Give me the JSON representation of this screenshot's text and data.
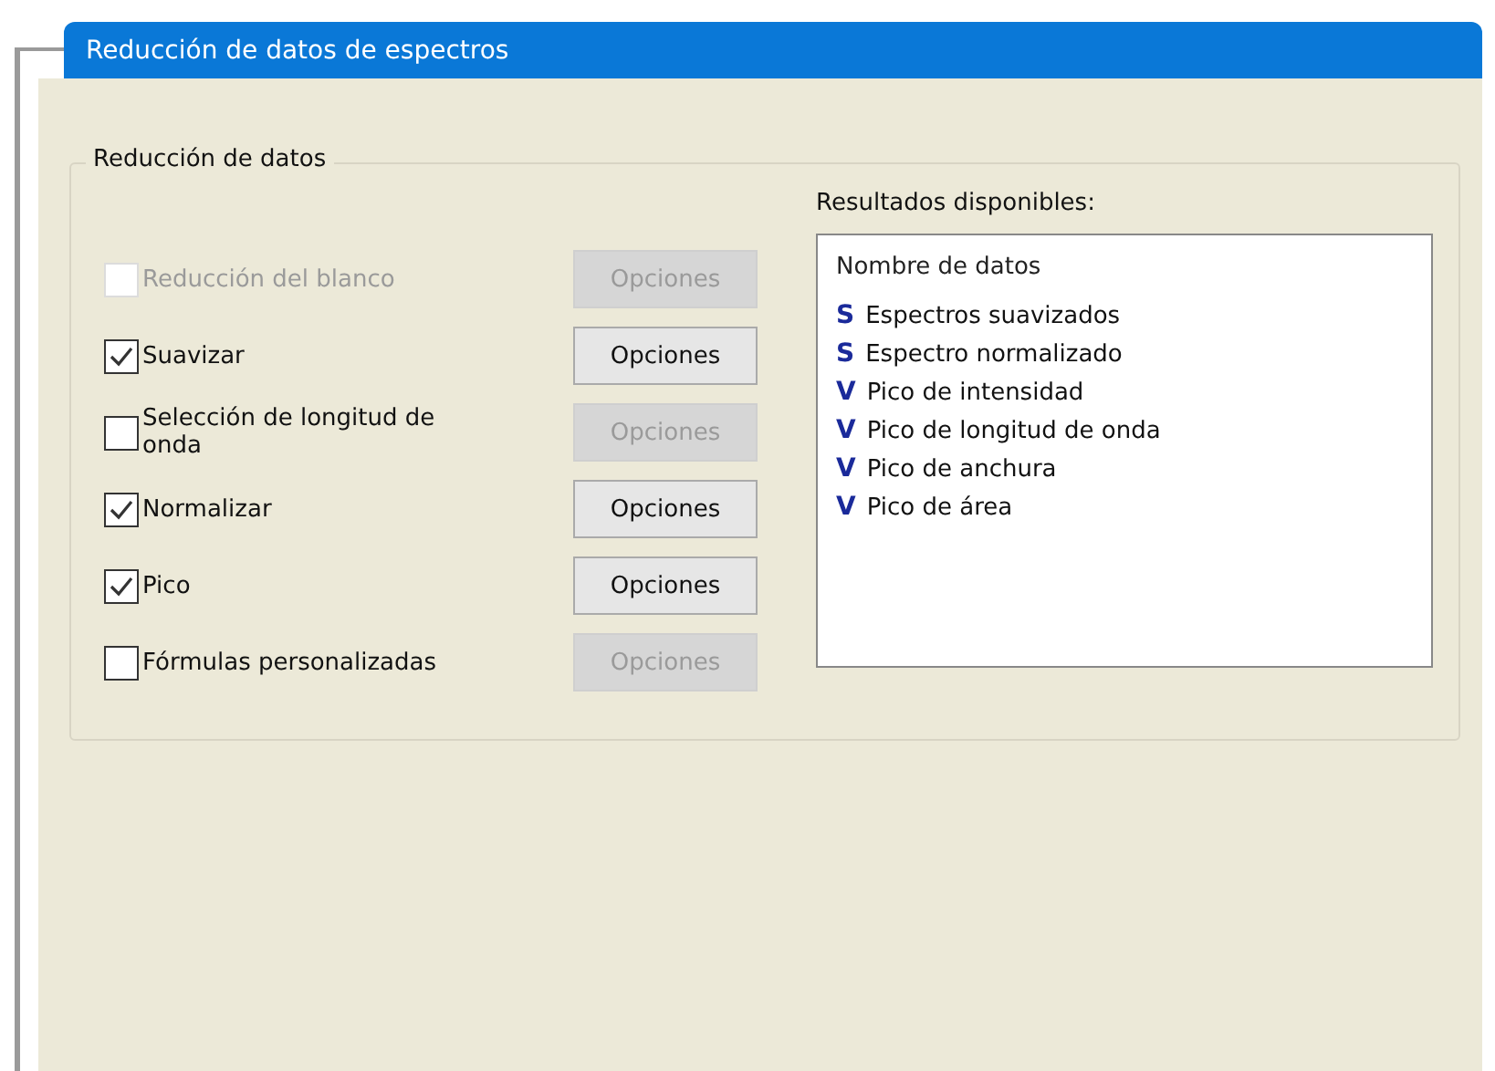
{
  "window": {
    "title": "Reducción de datos de espectros"
  },
  "group": {
    "title": "Reducción de datos",
    "options": [
      {
        "label": "Reducción del blanco",
        "checked": false,
        "disabled": true,
        "button": {
          "label": "Opciones",
          "disabled": true
        }
      },
      {
        "label": "Suavizar",
        "checked": true,
        "disabled": false,
        "button": {
          "label": "Opciones",
          "disabled": false
        }
      },
      {
        "label": "Selección de longitud de onda",
        "checked": false,
        "disabled": false,
        "button": {
          "label": "Opciones",
          "disabled": true
        }
      },
      {
        "label": "Normalizar",
        "checked": true,
        "disabled": false,
        "button": {
          "label": "Opciones",
          "disabled": false
        }
      },
      {
        "label": "Pico",
        "checked": true,
        "disabled": false,
        "button": {
          "label": "Opciones",
          "disabled": false
        }
      },
      {
        "label": "Fórmulas personalizadas",
        "checked": false,
        "disabled": false,
        "button": {
          "label": "Opciones",
          "disabled": true
        }
      }
    ],
    "results": {
      "title": "Resultados disponibles:",
      "header": "Nombre de datos",
      "items": [
        {
          "badge": "S",
          "label": "Espectros suavizados"
        },
        {
          "badge": "S",
          "label": "Espectro normalizado"
        },
        {
          "badge": "V",
          "label": "Pico de intensidad"
        },
        {
          "badge": "V",
          "label": "Pico de longitud de onda"
        },
        {
          "badge": "V",
          "label": "Pico de anchura"
        },
        {
          "badge": "V",
          "label": "Pico de área"
        }
      ]
    }
  }
}
